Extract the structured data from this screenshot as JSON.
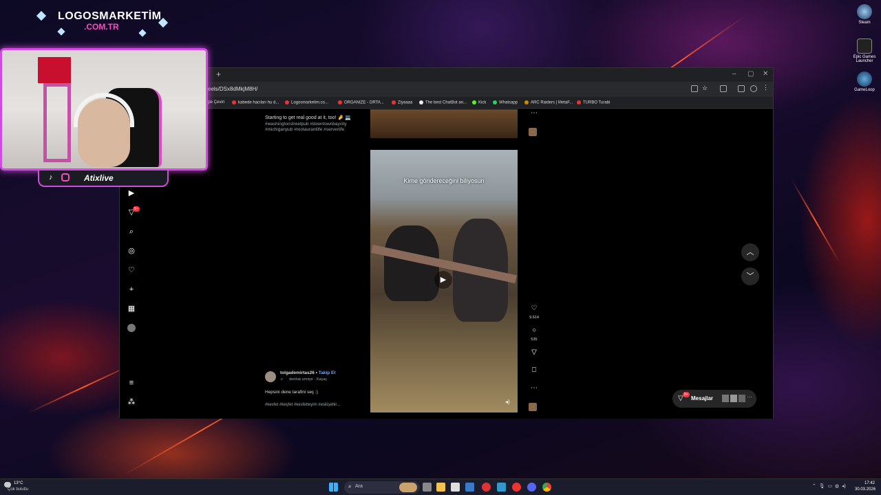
{
  "overlay": {
    "logo_line1": "LOGOSMARKETİM",
    "logo_line2": ".COM.TR",
    "streamer": "Atixlive"
  },
  "browser": {
    "url": "eels/DSx8dMkjM8H/",
    "bookmarks": [
      "gle Çeviri",
      "kabede hacıları hu d...",
      "Logosmarketim.co...",
      "ORGANIZE - ORTA...",
      "Ziyaaaa",
      "The best ChatBot an...",
      "Kick",
      "Whatsapp",
      "ARC Raiders | MetaF...",
      "TURBO Turabi"
    ]
  },
  "sidebar": {
    "notif_badge": "9+"
  },
  "reel1": {
    "caption": "Starting to get real good at it, too! 🤌 💻",
    "hashtags_line1": "#washingtonstreetpub #downtownbaycity",
    "hashtags_line2": "#michiganpub #restaurantlife #serverlife"
  },
  "reel2": {
    "overlay_text": "Kime göndereceğini biliyosun",
    "username": "tolgademirtas26",
    "follow": "Takip Et",
    "audio": "denhat urmiye · Kaçaç",
    "caption": "Hepsini dene tarafini seç :)",
    "hashtags": "#kesfet #keşfet #kesfetteyim #eskişehir...",
    "likes": "9.614",
    "comments": "535"
  },
  "messages": {
    "label": "Mesajlar",
    "badge": "9+"
  },
  "desktop": {
    "icons": [
      "Steam",
      "Epic Games Launcher",
      "GameLoop"
    ]
  },
  "taskbar": {
    "weather_temp": "13°C",
    "weather_desc": "Çok bulutlu",
    "search": "Ara",
    "time": "17:42",
    "date": "30.03.2026"
  }
}
